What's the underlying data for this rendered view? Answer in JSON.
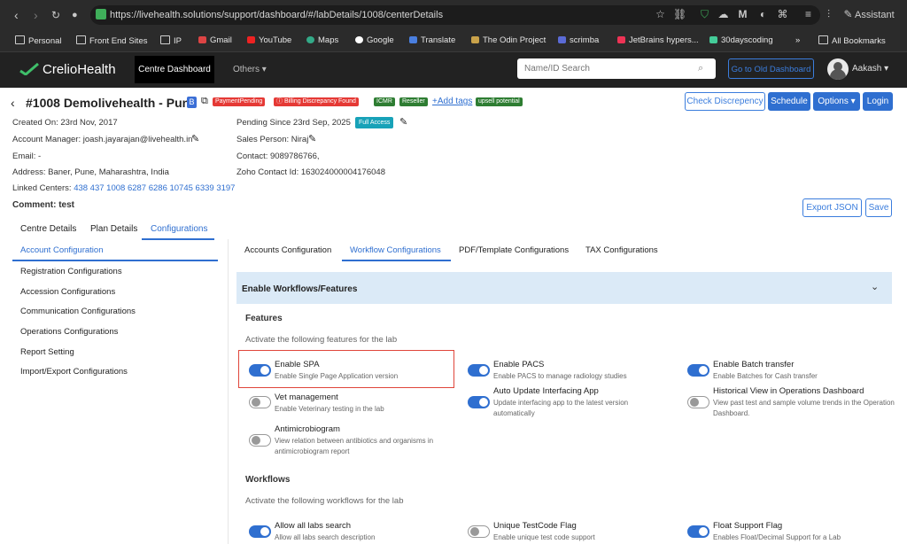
{
  "browser": {
    "url": "https://livehealth.solutions/support/dashboard/#/labDetails/1008/centerDetails",
    "assistant_label": "Assistant",
    "bookmarks": [
      "Personal",
      "Front End Sites",
      "IP",
      "Gmail",
      "YouTube",
      "Maps",
      "Google",
      "Translate",
      "The Odin Project",
      "scrimba",
      "JetBrains hypers...",
      "30dayscoding",
      "»",
      "All Bookmarks"
    ]
  },
  "header": {
    "logo_prefix": "Crelio",
    "logo_suffix": "Health",
    "centre_dashboard": "Centre Dashboard",
    "others": "Others",
    "search_placeholder": "Name/ID Search",
    "old_dashboard": "Go to Old Dashboard",
    "user_name": "Aakash"
  },
  "lab": {
    "title": "#1008 Demolivehealth - Pune",
    "b_badge": "B",
    "badges": [
      "PaymentPending",
      "Billing Discrepancy Found",
      "ICMR",
      "Reseller"
    ],
    "add_tags": "+Add tags",
    "upsell": "upsell potential",
    "actions": [
      "Check Discrepency",
      "Schedule",
      "Options",
      "Login"
    ]
  },
  "info": {
    "created_on": "Created On: 23rd Nov, 2017",
    "account_manager": "Account Manager: joash.jayarajan@livehealth.in",
    "email": "Email: -",
    "address": "Address: Baner, Pune, Maharashtra, India",
    "linked_label": "Linked Centers:",
    "linked_centers": "438 437 1008 6287 6286 10745 6339 3197",
    "pending_since": "Pending Since 23rd Sep, 2025",
    "full_access": "Full Access",
    "sales_person": "Sales Person: Niraj",
    "contact": "Contact: 9089786766,",
    "zoho": "Zoho Contact Id: 163024000004176048",
    "comment": "Comment: test"
  },
  "toolbar": {
    "export_json": "Export JSON",
    "save": "Save"
  },
  "tabs": [
    "Centre Details",
    "Plan Details",
    "Configurations"
  ],
  "sidebar": [
    "Account Configuration",
    "Registration Configurations",
    "Accession Configurations",
    "Communication Configurations",
    "Operations Configurations",
    "Report Setting",
    "Import/Export Configurations"
  ],
  "subtabs": [
    "Accounts Configuration",
    "Workflow Configurations",
    "PDF/Template Configurations",
    "TAX Configurations"
  ],
  "section": {
    "title": "Enable Workflows/Features"
  },
  "features": {
    "heading": "Features",
    "subtitle": "Activate the following features for the lab",
    "items": [
      {
        "title": "Enable SPA",
        "desc": "Enable Single Page Application version",
        "on": true
      },
      {
        "title": "Enable PACS",
        "desc": "Enable PACS to manage radiology studies",
        "on": true
      },
      {
        "title": "Enable Batch transfer",
        "desc": "Enable Batches for Cash transfer",
        "on": true
      },
      {
        "title": "Vet management",
        "desc": "Enable Veterinary testing in the lab",
        "on": false
      },
      {
        "title": "Auto Update Interfacing App",
        "desc": "Update interfacing app to the latest version automatically",
        "on": true
      },
      {
        "title": "Historical View in Operations Dashboard",
        "desc": "View past test and sample volume trends in the Operation Dashboard.",
        "on": false
      },
      {
        "title": "Antimicrobiogram",
        "desc": "View relation between antibiotics and organisms in antimicrobiogram report",
        "on": false
      }
    ]
  },
  "workflows": {
    "heading": "Workflows",
    "subtitle": "Activate the following workflows for the lab",
    "items": [
      {
        "title": "Allow all labs search",
        "desc": "Allow all labs search description",
        "on": true
      },
      {
        "title": "Unique TestCode Flag",
        "desc": "Enable unique test code support",
        "on": false
      },
      {
        "title": "Float Support Flag",
        "desc": "Enables Float/Decimal Support for a Lab",
        "on": true
      }
    ]
  }
}
